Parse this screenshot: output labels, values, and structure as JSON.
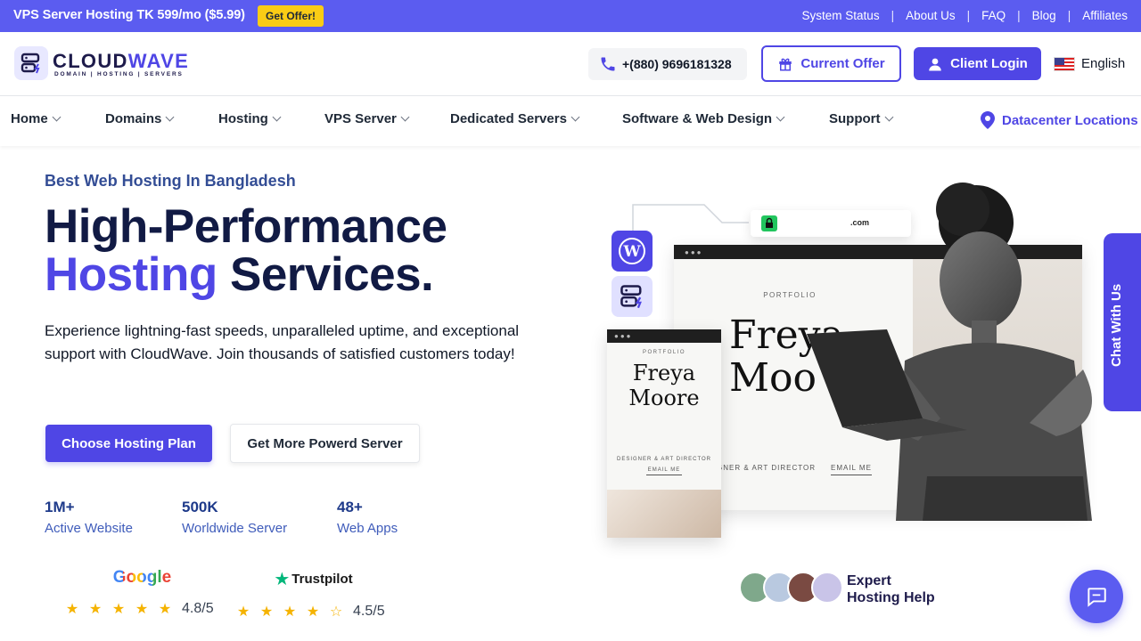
{
  "topbar": {
    "promo": "VPS Server Hosting TK 599/mo ($5.99)",
    "offer_badge": "Get Offer!",
    "links": [
      "System Status",
      "About Us",
      "FAQ",
      "Blog",
      "Affiliates"
    ]
  },
  "header": {
    "logo_text_a": "CLOUD",
    "logo_text_b": "WAVE",
    "logo_tagline": "DOMAIN | HOSTING | SERVERS",
    "phone": "+(880) 9696181328",
    "current_offer": "Current Offer",
    "client_login": "Client Login",
    "language": "English"
  },
  "nav": {
    "items": [
      "Home",
      "Domains",
      "Hosting",
      "VPS Server",
      "Dedicated Servers",
      "Software & Web Design",
      "Support"
    ],
    "datacenter": "Datacenter Locations"
  },
  "hero": {
    "eyebrow": "Best Web Hosting In Bangladesh",
    "title_line1": "High-Performance",
    "title_accent": "Hosting",
    "title_rest": " Services.",
    "description": "Experience lightning-fast speeds, unparalleled uptime, and exceptional support with CloudWave. Join thousands of satisfied customers today!",
    "primary_cta": "Choose Hosting Plan",
    "secondary_cta": "Get More Powerd Server"
  },
  "stats": [
    {
      "value": "1M+",
      "label": "Active Website"
    },
    {
      "value": "500K",
      "label": "Worldwide Server"
    },
    {
      "value": "48+",
      "label": "Web Apps"
    }
  ],
  "reviews": [
    {
      "source": "Google",
      "rating": "4.8/5",
      "stars": 5
    },
    {
      "source": "Trustpilot",
      "rating": "4.5/5",
      "stars": 4.5
    }
  ],
  "art": {
    "url_suffix": ".com",
    "portfolio": "PORTFOLIO",
    "name_first": "Freya",
    "name_last": "Moore",
    "role": "DESIGNER & ART DIRECTOR",
    "email_me": "EMAIL ME",
    "big_name_first": "Freya",
    "big_name_last": "Moo",
    "big_role": "GNER & ART DIRECTOR"
  },
  "support": {
    "chat_side": "Chat With Us",
    "expert_line1": "Expert",
    "expert_line2": "Hosting Help"
  },
  "colors": {
    "primary": "#4f46e5",
    "topbar": "#5b5cf0",
    "badge": "#facc15",
    "star": "#f5b300"
  }
}
